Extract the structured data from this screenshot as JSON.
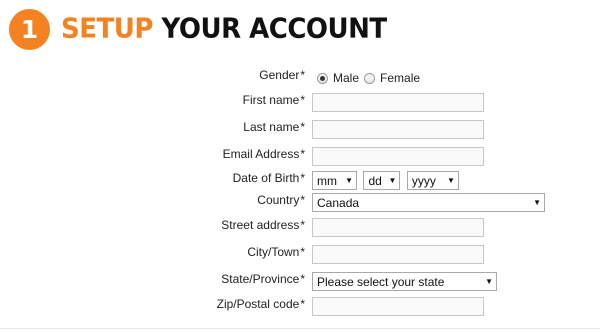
{
  "header": {
    "step_number": "1",
    "title_accent": "SETUP",
    "title_rest": "YOUR ACCOUNT",
    "accent_color": "#f58220"
  },
  "form": {
    "gender": {
      "label": "Gender",
      "required_mark": "*",
      "options": [
        "Male",
        "Female"
      ],
      "selected": "Male"
    },
    "first_name": {
      "label": "First name",
      "required_mark": "*",
      "value": ""
    },
    "last_name": {
      "label": "Last name",
      "required_mark": "*",
      "value": ""
    },
    "email": {
      "label": "Email Address",
      "required_mark": "*",
      "value": ""
    },
    "dob": {
      "label": "Date of Birth",
      "required_mark": "*",
      "month": "mm",
      "day": "dd",
      "year": "yyyy"
    },
    "country": {
      "label": "Country",
      "required_mark": "*",
      "selected": "Canada"
    },
    "street": {
      "label": "Street address",
      "required_mark": "*",
      "value": ""
    },
    "city": {
      "label": "City/Town",
      "required_mark": "*",
      "value": ""
    },
    "state": {
      "label": "State/Province",
      "required_mark": "*",
      "selected": "Please select your state"
    },
    "zip": {
      "label": "Zip/Postal code",
      "required_mark": "*",
      "value": ""
    }
  },
  "icons": {
    "dropdown": "chevron-down-icon"
  }
}
